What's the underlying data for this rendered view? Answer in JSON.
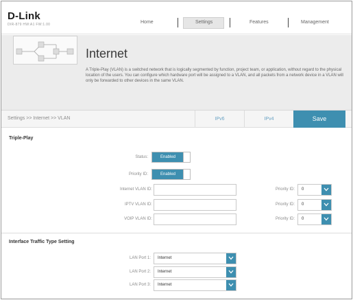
{
  "header": {
    "logo": "D-Link",
    "model": "DIR-879 HW:A1 FW:1.00",
    "nav": [
      "Home",
      "Settings",
      "Features",
      "Management"
    ],
    "active_nav": "Settings"
  },
  "banner": {
    "title": "Internet",
    "description": "A Triple-Play (VLAN) is a switched network that is logically segmented by function, project team, or application, without regard to the physical location of the users. You can configure which hardware port will be assigned to a VLAN, and all packets from a network device in a VLAN will only be forwarded to other devices in the same VLAN."
  },
  "breadcrumb": "Settings >> Internet >> VLAN",
  "actions": {
    "ipv6": "IPv6",
    "ipv4": "IPv4",
    "save": "Save"
  },
  "triple_play": {
    "title": "Triple-Play",
    "status_label": "Status:",
    "status_value": "Enabled",
    "priority_id_label": "Priority ID:",
    "priority_id_value": "Enabled",
    "rows": [
      {
        "label": "Internet VLAN ID:",
        "value": "",
        "priority_label": "Priority ID:",
        "priority_value": "0"
      },
      {
        "label": "IPTV VLAN ID:",
        "value": "",
        "priority_label": "Priority ID:",
        "priority_value": "0"
      },
      {
        "label": "VOIP VLAN ID:",
        "value": "",
        "priority_label": "Priority ID:",
        "priority_value": "0"
      }
    ]
  },
  "interface_traffic": {
    "title": "Interface Traffic Type Setting",
    "ports": [
      {
        "label": "LAN Port 1:",
        "value": "Internet"
      },
      {
        "label": "LAN Port 2:",
        "value": "Internet"
      },
      {
        "label": "LAN Port 3:",
        "value": "Internet"
      }
    ]
  },
  "colors": {
    "accent": "#3e8fb0",
    "link": "#6aa3c4"
  },
  "icons": [
    "chevron-down-icon",
    "network-diagram-icon"
  ]
}
